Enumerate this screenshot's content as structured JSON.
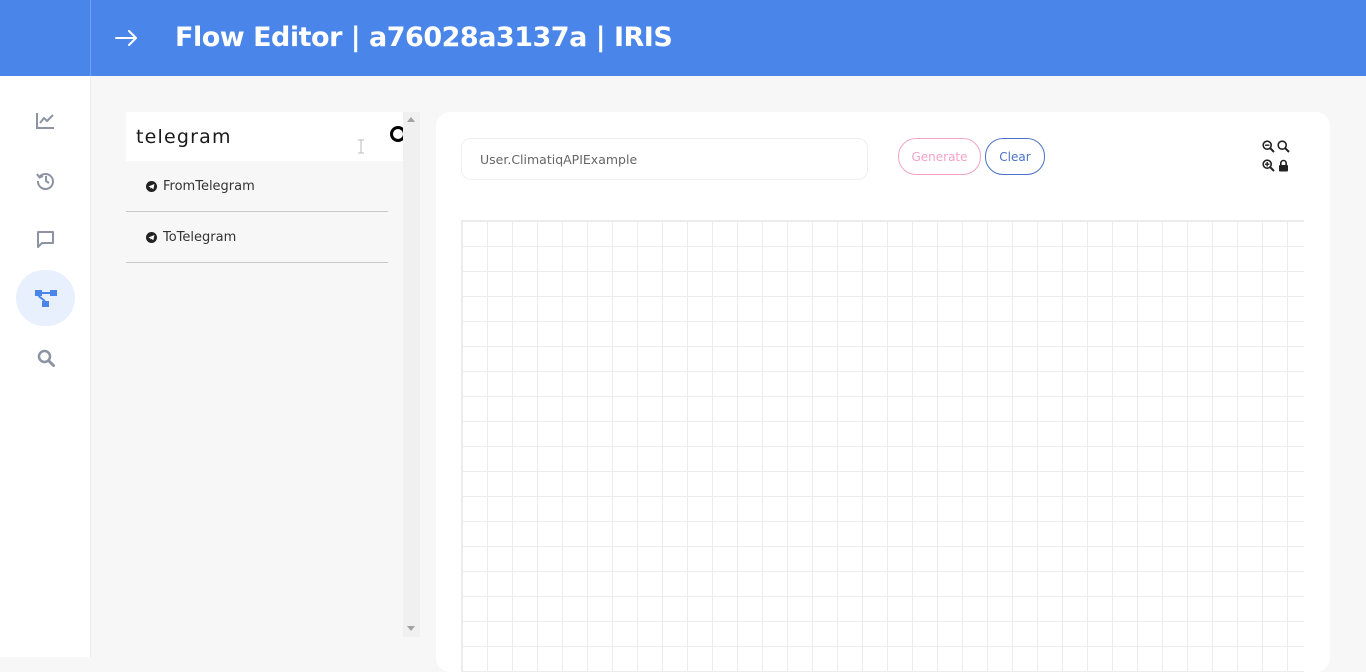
{
  "header": {
    "title": "Flow Editor | a76028a3137a | IRIS",
    "background_color": "#4a86ea"
  },
  "sidebar": {
    "items": [
      {
        "icon": "chart-line-icon",
        "active": false
      },
      {
        "icon": "history-icon",
        "active": false
      },
      {
        "icon": "message-icon",
        "active": false
      },
      {
        "icon": "flow-diagram-icon",
        "active": true
      },
      {
        "icon": "search-icon",
        "active": false
      }
    ],
    "accent_color": "#4a86ea"
  },
  "component_panel": {
    "search_value": "telegram",
    "items": [
      {
        "label": "FromTelegram",
        "icon": "telegram-icon"
      },
      {
        "label": "ToTelegram",
        "icon": "telegram-icon"
      }
    ]
  },
  "editor": {
    "flow_name_value": "User.ClimatiqAPIExample",
    "generate_label": "Generate",
    "clear_label": "Clear",
    "generate_color": "#f3a3c6",
    "clear_color": "#4a72c8",
    "zoom_controls": [
      "zoom-out-icon",
      "zoom-reset-icon",
      "zoom-in-icon",
      "lock-icon"
    ]
  }
}
